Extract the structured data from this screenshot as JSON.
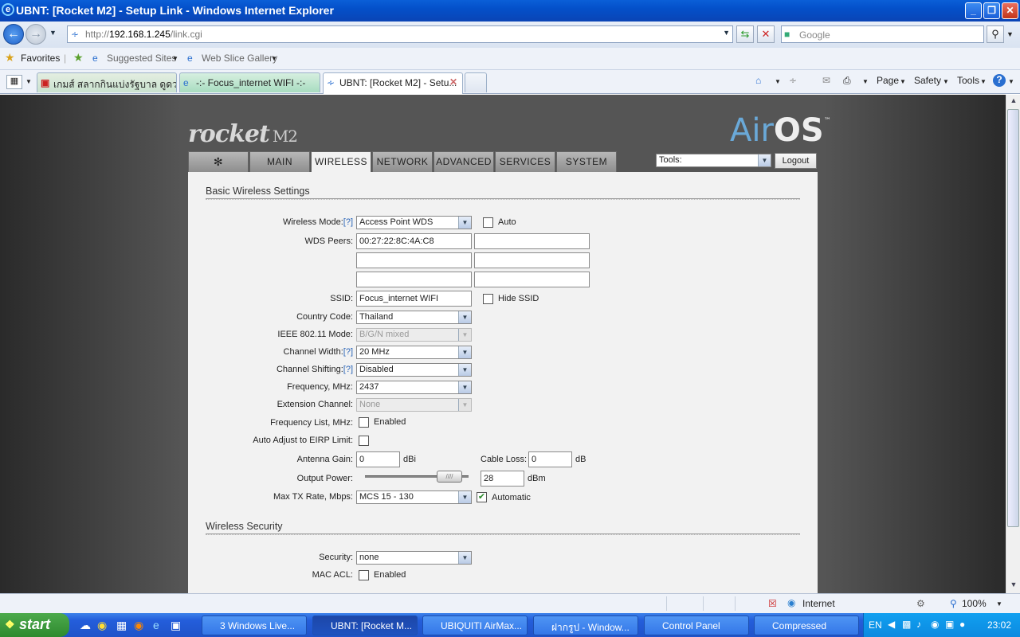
{
  "window": {
    "title": "UBNT: [Rocket M2] - Setup Link - Windows Internet Explorer",
    "controls": [
      "_",
      "❐",
      "✕"
    ]
  },
  "address": {
    "url_prefix": "http://",
    "url_host": "192.168.1.245",
    "url_path": "/link.cgi",
    "search_placeholder": "Google"
  },
  "favorites": {
    "favorites_label": "Favorites",
    "suggested_sites": "Suggested Sites",
    "web_slice_gallery": "Web Slice Gallery"
  },
  "tabs": [
    {
      "label": "เกมส์ สลากกินแบ่งรัฐบาล ดูดว..."
    },
    {
      "label": "-:- Focus_internet WIFI -:-"
    },
    {
      "label": "UBNT: [Rocket M2] - Setu..."
    }
  ],
  "commands": {
    "page": "Page",
    "safety": "Safety",
    "tools": "Tools"
  },
  "ubnt": {
    "brand": "rocket",
    "model": "M2",
    "airos_air": "Air",
    "airos_os": "OS",
    "trademark": "™",
    "nav": [
      "MAIN",
      "WIRELESS",
      "NETWORK",
      "ADVANCED",
      "SERVICES",
      "SYSTEM"
    ],
    "tools_select": "Tools:",
    "logout": "Logout"
  },
  "basic": {
    "title": "Basic Wireless Settings",
    "wireless_mode_label": "Wireless Mode:",
    "help": "[?]",
    "wireless_mode_value": "Access Point WDS",
    "auto_label": "Auto",
    "wds_peers_label": "WDS Peers:",
    "wds_peer_1": "00:27:22:8C:4A:C8",
    "ssid_label": "SSID:",
    "ssid_value": "Focus_internet WIFI",
    "hide_ssid_label": "Hide SSID",
    "country_label": "Country Code:",
    "country_value": "Thailand",
    "ieee_label": "IEEE 802.11 Mode:",
    "ieee_value": "B/G/N mixed",
    "channel_width_label": "Channel Width:",
    "channel_width_value": "20 MHz",
    "channel_shifting_label": "Channel Shifting:",
    "channel_shifting_value": "Disabled",
    "frequency_label": "Frequency, MHz:",
    "frequency_value": "2437",
    "ext_channel_label": "Extension Channel:",
    "ext_channel_value": "None",
    "freq_list_label": "Frequency List, MHz:",
    "enabled": "Enabled",
    "auto_eirp_label": "Auto Adjust to EIRP Limit:",
    "antenna_gain_label": "Antenna Gain:",
    "antenna_gain_value": "0",
    "dbi": "dBi",
    "cable_loss_label": "Cable Loss:",
    "cable_loss_value": "0",
    "db": "dB",
    "output_power_label": "Output Power:",
    "output_power_value": "28",
    "output_power_fraction": 0.88,
    "dbm": "dBm",
    "max_tx_label": "Max TX Rate, Mbps:",
    "max_tx_value": "MCS 15 - 130",
    "automatic_label": "Automatic",
    "automatic_checked": true
  },
  "security": {
    "title": "Wireless Security",
    "security_label": "Security:",
    "security_value": "none",
    "mac_acl_label": "MAC ACL:",
    "enabled": "Enabled"
  },
  "status": {
    "zone": "Internet",
    "zoom": "100%"
  },
  "taskbar": {
    "start": "start",
    "tasks": [
      "3 Windows Live...",
      "UBNT: [Rocket M...",
      "UBIQUITI AirMax...",
      "ฝากรูป - Window...",
      "Control Panel",
      "Compressed"
    ],
    "lang": "EN",
    "clock": "23:02"
  },
  "colors": {
    "airos_blue": "#6aa9d8",
    "help_link": "#2a64b8",
    "check_green": "#2a8a2a"
  }
}
